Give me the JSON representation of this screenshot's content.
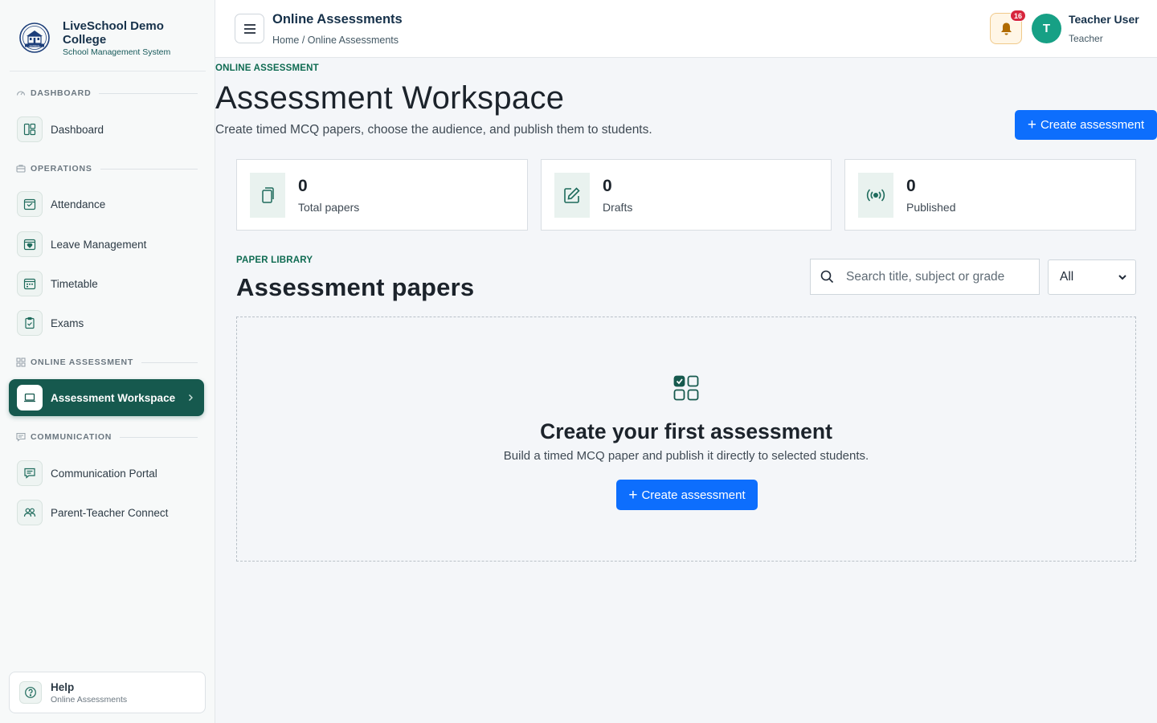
{
  "brand": {
    "name": "LiveSchool Demo College",
    "subtitle": "School Management System",
    "logo_text": "SCHOOL"
  },
  "sidebar": {
    "sections": [
      {
        "label": "DASHBOARD",
        "icon": "gauge-icon"
      },
      {
        "label": "OPERATIONS",
        "icon": "briefcase-icon"
      },
      {
        "label": "ONLINE ASSESSMENT",
        "icon": "grid-icon"
      },
      {
        "label": "COMMUNICATION",
        "icon": "message-icon"
      }
    ],
    "items": [
      {
        "label": "Dashboard",
        "icon": "layout-icon"
      },
      {
        "label": "Attendance",
        "icon": "calendar-check-icon"
      },
      {
        "label": "Leave Management",
        "icon": "calendar-heart-icon"
      },
      {
        "label": "Timetable",
        "icon": "calendar-week-icon"
      },
      {
        "label": "Exams",
        "icon": "clipboard-check-icon"
      },
      {
        "label": "Assessment Workspace",
        "icon": "laptop-icon",
        "active": true
      },
      {
        "label": "Communication Portal",
        "icon": "chat-icon"
      },
      {
        "label": "Parent-Teacher Connect",
        "icon": "people-icon"
      }
    ],
    "help": {
      "title": "Help",
      "subtitle": "Online Assessments"
    }
  },
  "topbar": {
    "title": "Online Assessments",
    "breadcrumb": "Home / Online Assessments",
    "notification_count": "16",
    "user": {
      "initial": "T",
      "name": "Teacher User",
      "role": "Teacher"
    }
  },
  "header": {
    "eyebrow": "ONLINE ASSESSMENT",
    "title": "Assessment Workspace",
    "subtitle": "Create timed MCQ papers, choose the audience, and publish them to students.",
    "create_label": "Create assessment"
  },
  "stats": [
    {
      "value": "0",
      "label": "Total papers",
      "icon": "files-icon"
    },
    {
      "value": "0",
      "label": "Drafts",
      "icon": "pencil-square-icon"
    },
    {
      "value": "0",
      "label": "Published",
      "icon": "broadcast-icon"
    }
  ],
  "library": {
    "eyebrow": "PAPER LIBRARY",
    "title": "Assessment papers",
    "search_placeholder": "Search title, subject or grade",
    "filter_value": "All"
  },
  "empty_state": {
    "title": "Create your first assessment",
    "subtitle": "Build a timed MCQ paper and publish it directly to selected students.",
    "button_label": "Create assessment"
  },
  "colors": {
    "accent": "#16594e",
    "primary_button": "#0d6efd",
    "badge": "#d7263d",
    "avatar": "#17a085"
  }
}
